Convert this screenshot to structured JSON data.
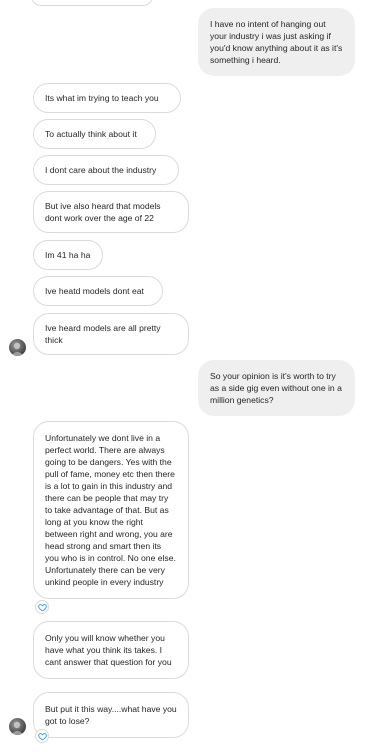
{
  "colors": {
    "accent_heart": "#3897f0",
    "incoming_border": "#dbdbdb",
    "outgoing_bg": "#efefef"
  },
  "avatar_icon": "user-avatar-icon",
  "heart_icon": "heart-reaction-icon",
  "messages": [
    {
      "from": "me",
      "text": "I have no intent of hanging out your industry i was just asking if you'd know anything about it as it's something i heard."
    },
    {
      "from": "them",
      "text": "Its what im trying to teach you"
    },
    {
      "from": "them",
      "text": "To actually think about it"
    },
    {
      "from": "them",
      "text": "I dont care about the industry"
    },
    {
      "from": "them",
      "text": "But ive also heard that models dont work over the age of 22"
    },
    {
      "from": "them",
      "text": "Im 41 ha ha"
    },
    {
      "from": "them",
      "text": "Ive heatd models dont eat"
    },
    {
      "from": "them",
      "text": "Ive heard models are all pretty thick"
    },
    {
      "from": "me",
      "text": "So your opinion is it's worth to try as a side gig even without one in a million genetics?"
    },
    {
      "from": "them",
      "text": "Unfortunately we dont live in a perfect world. There are always going to be dangers. Yes with the pull of fame, money etc then there is a lot to gain in this industry and there can be people that may try to take advantage of that. But as long at you know the right between right and wrong, you are head strong and smart then its you who is in control. No one else. Unfortunately there can be very unkind people in every industry"
    },
    {
      "from": "them",
      "text": "Only you will know whether you have what you think its takes. I cant answer that question for you"
    },
    {
      "from": "them",
      "text": "But put it this way....what have you got to lose?"
    }
  ]
}
